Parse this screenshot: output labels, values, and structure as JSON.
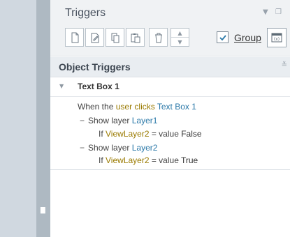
{
  "panel": {
    "title": "Triggers",
    "group_label": "Group",
    "group_checked": true
  },
  "toolbar": {
    "buttons": [
      {
        "icon": "new-page-icon"
      },
      {
        "icon": "edit-page-icon"
      },
      {
        "icon": "copy-icon"
      },
      {
        "icon": "paste-icon"
      },
      {
        "icon": "delete-icon"
      }
    ],
    "spinner": {
      "up": "move-up-icon",
      "down": "move-down-icon"
    },
    "variables_icon": "variables-icon"
  },
  "section": {
    "title": "Object Triggers"
  },
  "item": {
    "name": "Text Box 1"
  },
  "trigger": {
    "when": "When the",
    "user_clicks": "user clicks",
    "target": "Text Box 1",
    "actions": [
      {
        "action": "Show layer",
        "layer": "Layer1",
        "if": "If",
        "variable": "ViewLayer2",
        "eq": "= value",
        "value": "False"
      },
      {
        "action": "Show layer",
        "layer": "Layer2",
        "if": "If",
        "variable": "ViewLayer2",
        "eq": "= value",
        "value": "True"
      }
    ]
  },
  "colors": {
    "accent_blue": "#2a78a8",
    "variable_gold": "#9a7a00"
  }
}
